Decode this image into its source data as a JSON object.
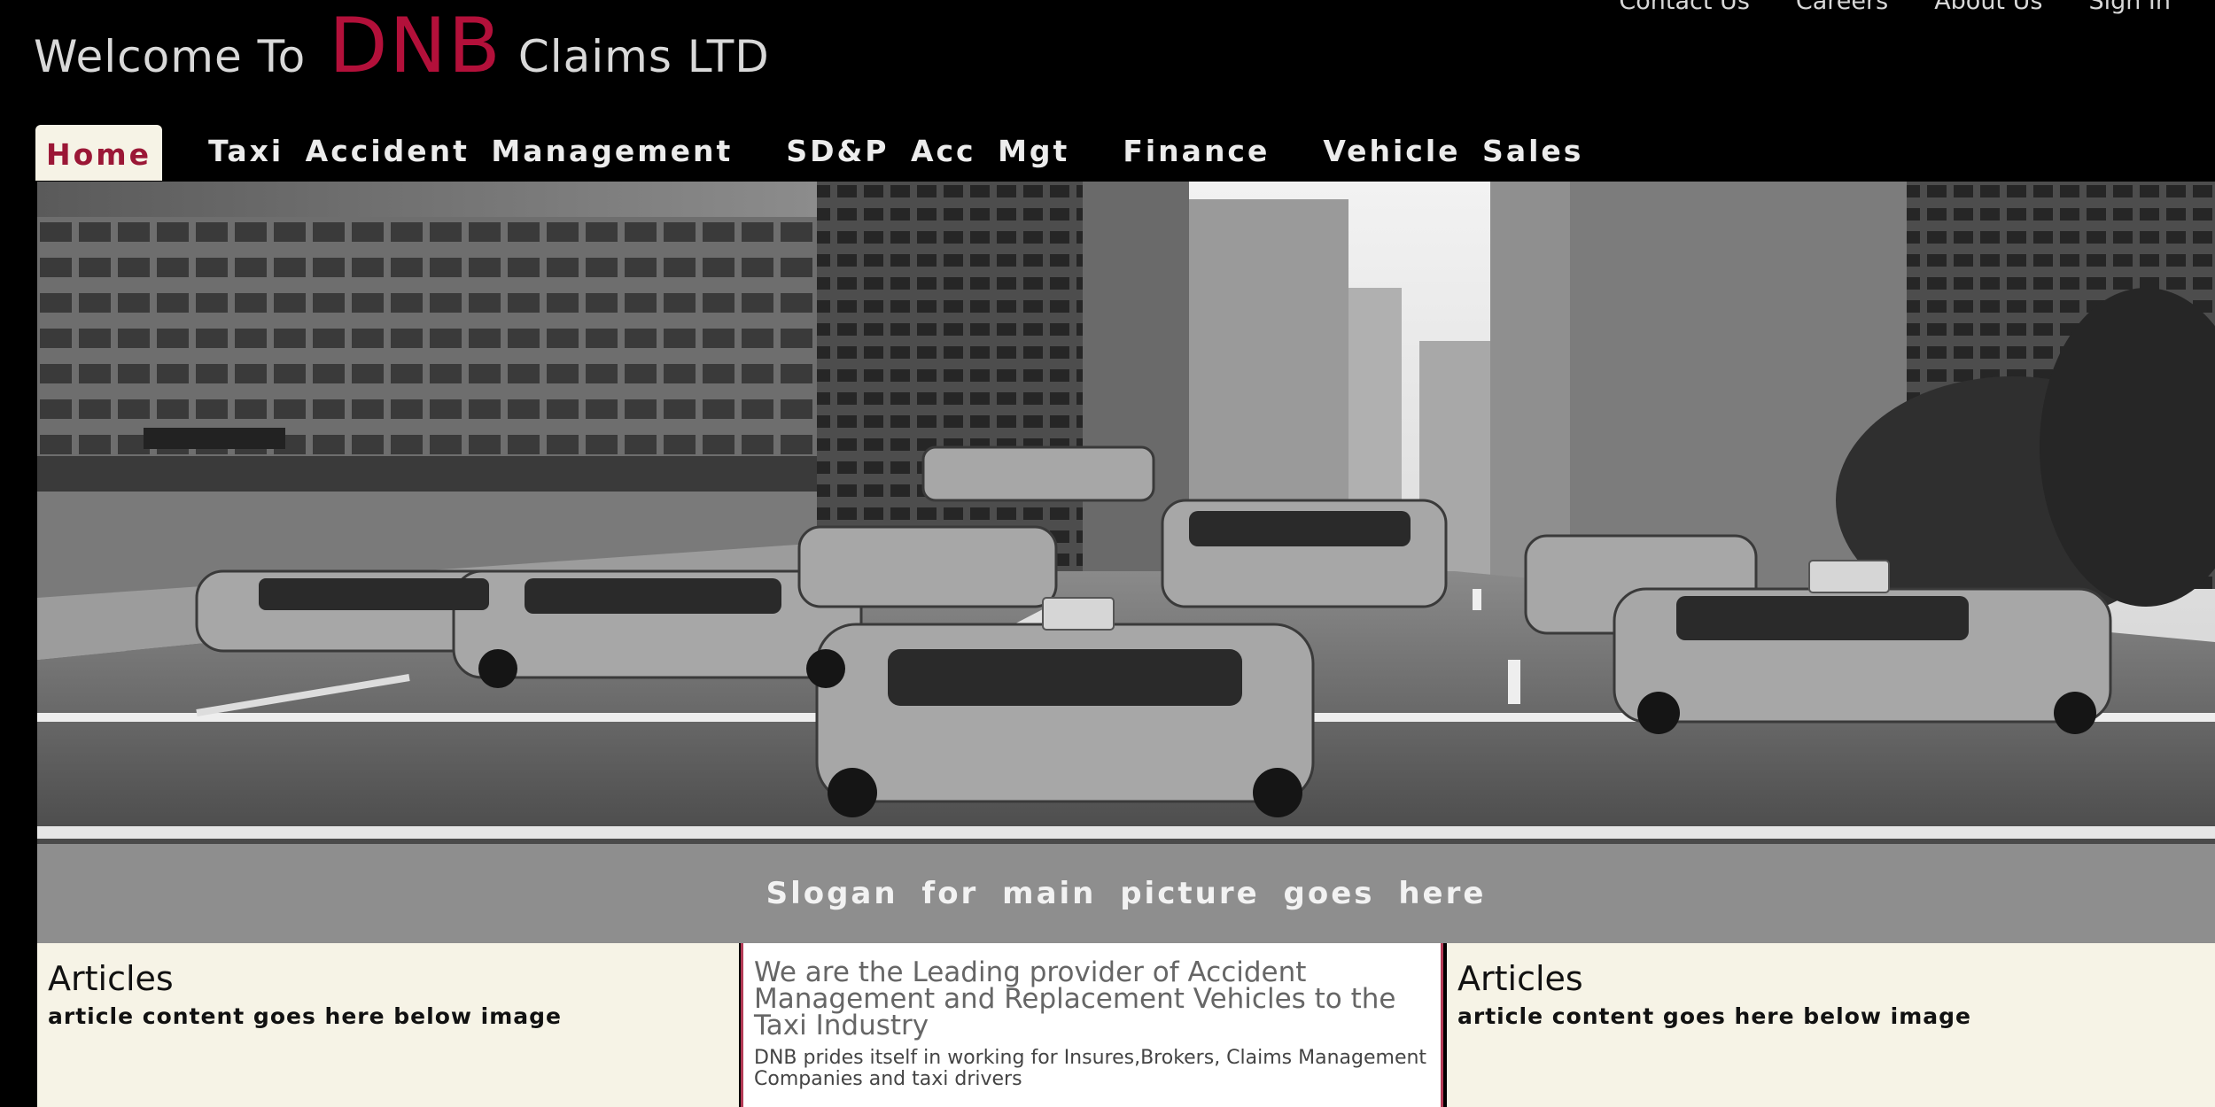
{
  "header": {
    "welcome_prefix": "Welcome To",
    "brand": "DNB",
    "welcome_suffix": "Claims LTD",
    "top_links": [
      "Contact Us",
      "Careers",
      "About Us",
      "Sign In"
    ]
  },
  "nav": {
    "items": [
      "Home",
      "Taxi Accident Management",
      "SD&P Acc Mgt",
      "Finance",
      "Vehicle Sales"
    ],
    "active": "Home"
  },
  "hero": {
    "slogan": "Slogan for main picture goes here"
  },
  "panels": {
    "left": {
      "title": "Articles",
      "body": "article content goes here below image"
    },
    "middle": {
      "heading": "We are the Leading provider of Accident Management and Replacement Vehicles to the Taxi Industry",
      "body": "DNB prides itself in working for Insures,Brokers, Claims Management Companies and taxi drivers"
    },
    "right": {
      "title": "Articles",
      "body": "article content goes here below image"
    }
  },
  "colors": {
    "brand_red": "#b3103a",
    "header_bg": "#000000",
    "panel_cream": "#f6f3e6",
    "slogan_bar": "#8e8e8e",
    "divider": "#b33a55"
  }
}
